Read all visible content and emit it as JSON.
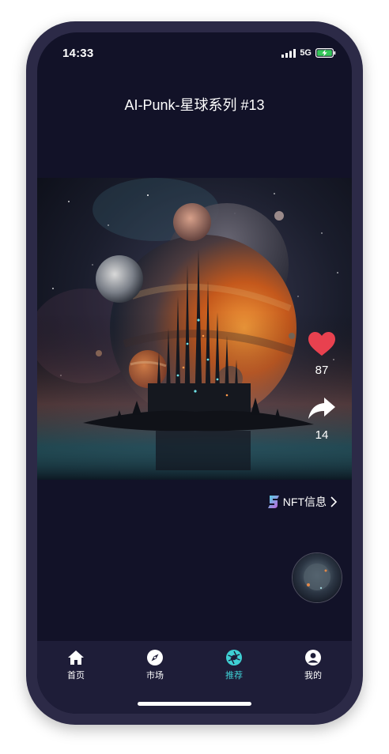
{
  "status_bar": {
    "time": "14:33",
    "network": "5G",
    "battery_charging": true
  },
  "header": {
    "title": "AI-Punk-星球系列 #13"
  },
  "artwork": {
    "icon": "planet-city-artwork"
  },
  "actions": {
    "like": {
      "icon": "heart-icon",
      "count": "87",
      "color": "#e8414f"
    },
    "share": {
      "icon": "share-icon",
      "count": "14"
    }
  },
  "nft_link": {
    "icon": "s-logo-icon",
    "label": "NFT信息",
    "chevron": "chevron-right-icon"
  },
  "tabs": [
    {
      "label": "首页",
      "icon": "home-icon",
      "active": false
    },
    {
      "label": "市场",
      "icon": "compass-icon",
      "active": false
    },
    {
      "label": "推荐",
      "icon": "aperture-icon",
      "active": true
    },
    {
      "label": "我的",
      "icon": "user-icon",
      "active": false
    }
  ],
  "colors": {
    "background": "#121228",
    "tabbar": "#1e1d38",
    "accent": "#3fd0d4",
    "frame": "#2c2a47"
  }
}
